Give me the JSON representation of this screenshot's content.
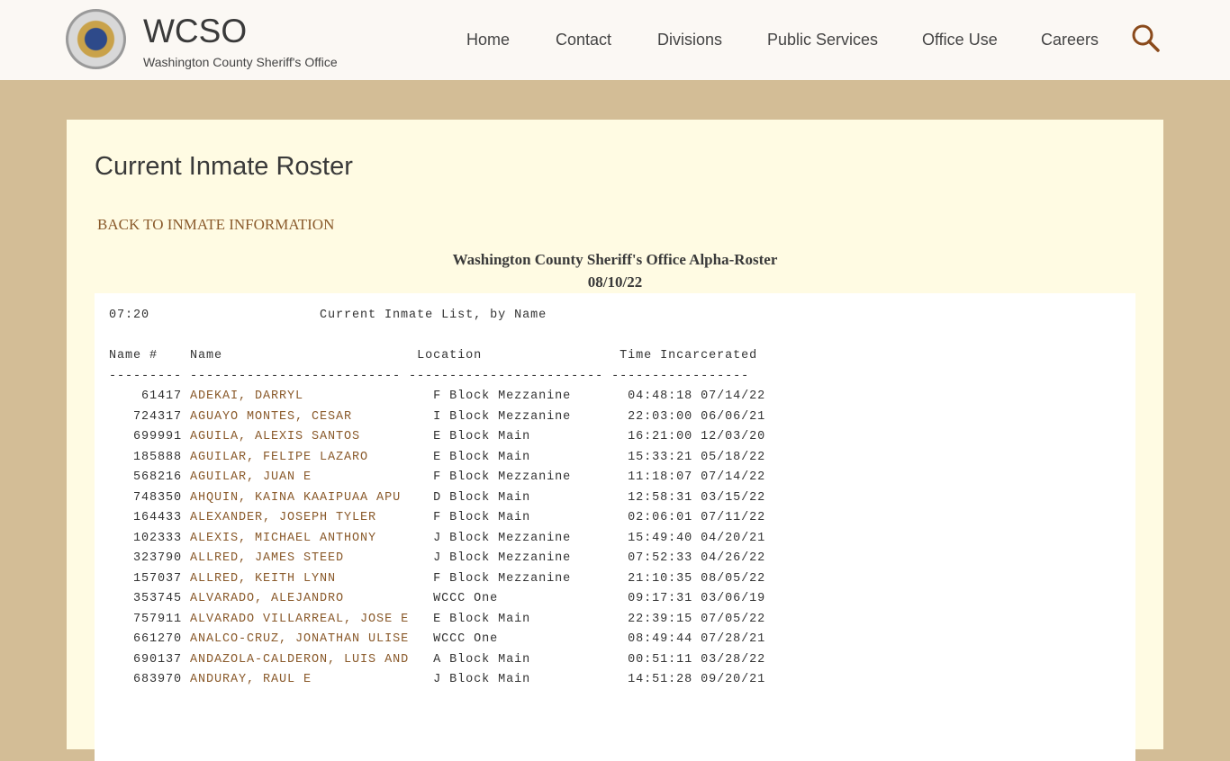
{
  "header": {
    "brand": "WCSO",
    "subtitle": "Washington County Sheriff's Office",
    "logo_text": "WASHINGTON COUNTY DEPUTY SHERIFF",
    "nav": [
      "Home",
      "Contact",
      "Divisions",
      "Public Services",
      "Office Use",
      "Careers"
    ],
    "search_icon": "search-icon"
  },
  "page": {
    "title": "Current Inmate Roster",
    "back_link": "BACK TO INMATE INFORMATION",
    "roster_title": "Washington County Sheriff's Office Alpha-Roster",
    "roster_date": "08/10/22"
  },
  "roster": {
    "time": "07:20",
    "heading": "Current Inmate List, by Name",
    "columns": [
      "Name #",
      "Name",
      "Location",
      "Time Incarcerated"
    ],
    "rows": [
      [
        "61417",
        "ADEKAI, DARRYL",
        "F Block Mezzanine",
        "04:48:18 07/14/22"
      ],
      [
        "724317",
        "AGUAYO MONTES, CESAR",
        "I Block Mezzanine",
        "22:03:00 06/06/21"
      ],
      [
        "699991",
        "AGUILA, ALEXIS SANTOS",
        "E Block Main",
        "16:21:00 12/03/20"
      ],
      [
        "185888",
        "AGUILAR, FELIPE LAZARO",
        "E Block Main",
        "15:33:21 05/18/22"
      ],
      [
        "568216",
        "AGUILAR, JUAN E",
        "F Block Mezzanine",
        "11:18:07 07/14/22"
      ],
      [
        "748350",
        "AHQUIN, KAINA KAAIPUAA APU",
        "D Block Main",
        "12:58:31 03/15/22"
      ],
      [
        "164433",
        "ALEXANDER, JOSEPH TYLER",
        "F Block Main",
        "02:06:01 07/11/22"
      ],
      [
        "102333",
        "ALEXIS, MICHAEL ANTHONY",
        "J Block Mezzanine",
        "15:49:40 04/20/21"
      ],
      [
        "323790",
        "ALLRED, JAMES STEED",
        "J Block Mezzanine",
        "07:52:33 04/26/22"
      ],
      [
        "157037",
        "ALLRED, KEITH LYNN",
        "F Block Mezzanine",
        "21:10:35 08/05/22"
      ],
      [
        "353745",
        "ALVARADO, ALEJANDRO",
        "WCCC One",
        "09:17:31 03/06/19"
      ],
      [
        "757911",
        "ALVARADO VILLARREAL, JOSE E",
        "E Block Main",
        "22:39:15 07/05/22"
      ],
      [
        "661270",
        "ANALCO-CRUZ, JONATHAN ULISE",
        "WCCC One",
        "08:49:44 07/28/21"
      ],
      [
        "690137",
        "ANDAZOLA-CALDERON, LUIS AND",
        "A Block Main",
        "00:51:11 03/28/22"
      ],
      [
        "683970",
        "ANDURAY, RAUL E",
        "J Block Main",
        "14:51:28 09/20/21"
      ]
    ]
  }
}
